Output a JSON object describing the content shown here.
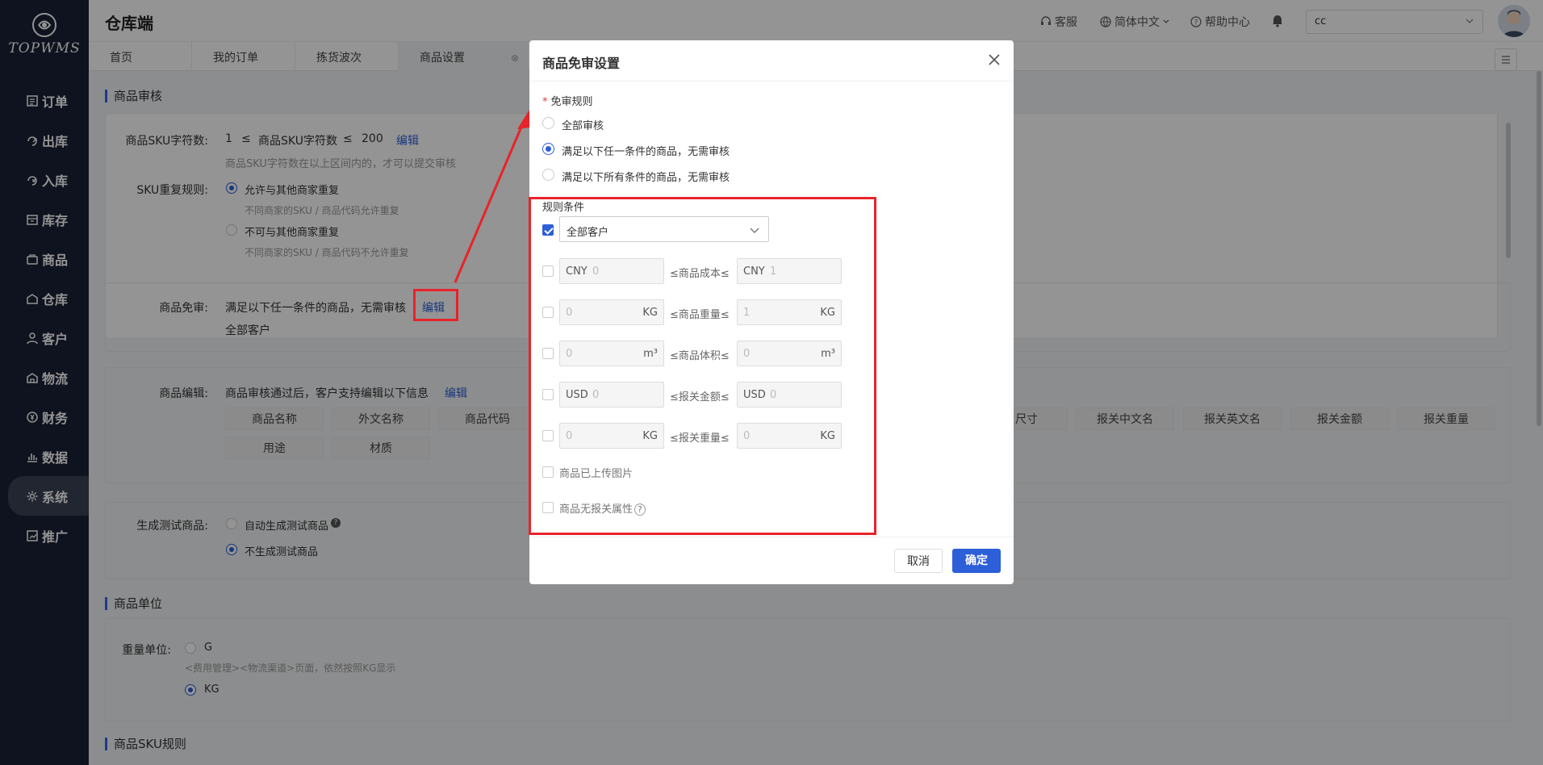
{
  "sidebar": {
    "logo": "TOPWMS",
    "items": [
      {
        "label": "订单",
        "icon": "order-icon"
      },
      {
        "label": "出库",
        "icon": "outbound-icon"
      },
      {
        "label": "入库",
        "icon": "inbound-icon"
      },
      {
        "label": "库存",
        "icon": "inventory-icon"
      },
      {
        "label": "商品",
        "icon": "product-icon"
      },
      {
        "label": "仓库",
        "icon": "warehouse-icon"
      },
      {
        "label": "客户",
        "icon": "customer-icon"
      },
      {
        "label": "物流",
        "icon": "logistics-icon"
      },
      {
        "label": "财务",
        "icon": "finance-icon"
      },
      {
        "label": "数据",
        "icon": "data-icon"
      },
      {
        "label": "系统",
        "icon": "system-icon",
        "active": true
      },
      {
        "label": "推广",
        "icon": "promotion-icon"
      }
    ]
  },
  "header": {
    "title": "仓库端",
    "service": "客服",
    "language": "简体中文",
    "help": "帮助中心",
    "select_value": "cc"
  },
  "tabs": [
    "首页",
    "我的订单",
    "拣货波次",
    "商品设置"
  ],
  "content": {
    "section_audit": "商品审核",
    "sku_len_label": "商品SKU字符数:",
    "sku_len_min": "1",
    "sku_len_op": "≤",
    "sku_len_mid": "商品SKU字符数",
    "sku_len_max": "200",
    "edit": "编辑",
    "sku_len_hint": "商品SKU字符数在以上区间内的，才可以提交审核",
    "sku_dup_label": "SKU重复规则:",
    "sku_dup_opt1": "允许与其他商家重复",
    "sku_dup_hint1": "不同商家的SKU / 商品代码允许重复",
    "sku_dup_opt2": "不可与其他商家重复",
    "sku_dup_hint2": "不同商家的SKU / 商品代码不允许重复",
    "exempt_label": "商品免审:",
    "exempt_value": "满足以下任一条件的商品，无需审核",
    "exempt_sub": "全部客户",
    "editable_label": "商品编辑:",
    "editable_value": "商品审核通过后，客户支持编辑以下信息",
    "chips_row1": [
      "商品名称",
      "外文名称",
      "商品代码"
    ],
    "chips_row1_right": [
      "尺寸",
      "报关中文名",
      "报关英文名",
      "报关金额",
      "报关重量"
    ],
    "chips_row2": [
      "用途",
      "材质"
    ],
    "test_label": "生成测试商品:",
    "test_opt1": "自动生成测试商品",
    "test_opt2": "不生成测试商品",
    "section_unit": "商品单位",
    "weight_label": "重量单位:",
    "weight_opt1": "G",
    "weight_hint": "<费用管理><物流渠道>页面，依然按照KG显示",
    "weight_opt2": "KG",
    "section_sku_rule": "商品SKU规则"
  },
  "modal": {
    "title": "商品免审设置",
    "rule_label": "免审规则",
    "required_mark": "*",
    "options": [
      "全部审核",
      "满足以下任一条件的商品，无需审核",
      "满足以下所有条件的商品，无需审核"
    ],
    "selected_option": 1,
    "conditions_label": "规则条件",
    "customer_select": "全部客户",
    "cost": {
      "currency": "CNY",
      "min": "0",
      "max": "1",
      "op": "≤商品成本≤"
    },
    "weight": {
      "min": "0",
      "max": "1",
      "unit": "KG",
      "op": "≤商品重量≤"
    },
    "volume": {
      "min": "0",
      "max": "0",
      "unit": "m³",
      "op": "≤商品体积≤"
    },
    "declare_amount": {
      "currency": "USD",
      "min": "0",
      "max": "0",
      "op": "≤报关金额≤"
    },
    "declare_weight": {
      "min": "0",
      "max": "0",
      "unit": "KG",
      "op": "≤报关重量≤"
    },
    "has_image": "商品已上传图片",
    "no_customs": "商品无报关属性",
    "cancel": "取消",
    "confirm": "确定"
  },
  "colors": {
    "accent": "#2c5fd8",
    "annotation": "#e8232a",
    "sidebar": "#1a2236"
  }
}
